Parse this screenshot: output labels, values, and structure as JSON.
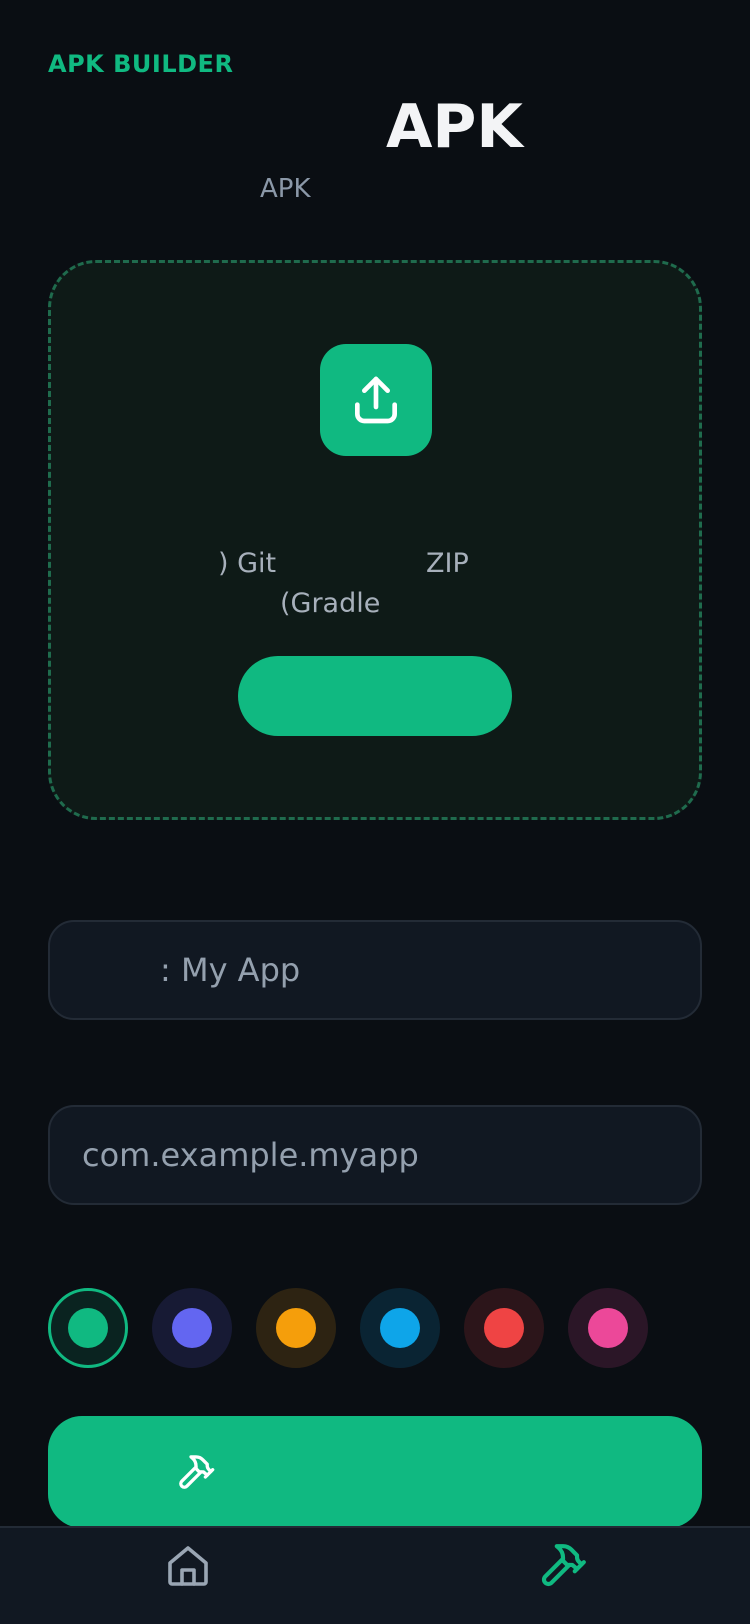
{
  "header": {
    "brand": "APK BUILDER",
    "title": "APK",
    "subtitle": "APK"
  },
  "dropzone": {
    "line1_a": ") Git",
    "line1_b": "ZIP",
    "line2": "(Gradle",
    "button_label": ""
  },
  "form": {
    "app_name_value": ": My App",
    "package_value": "com.example.myapp"
  },
  "colors": {
    "accent": "#10b981",
    "swatches": [
      "#10b981",
      "#6366f1",
      "#f59e0b",
      "#0ea5e9",
      "#ef4444",
      "#ec4899"
    ],
    "selected_index": 0
  },
  "build_button": {
    "label": ""
  },
  "nav": {
    "items": [
      {
        "icon": "home-icon",
        "active": false
      },
      {
        "icon": "hammer-icon",
        "active": true
      }
    ]
  }
}
